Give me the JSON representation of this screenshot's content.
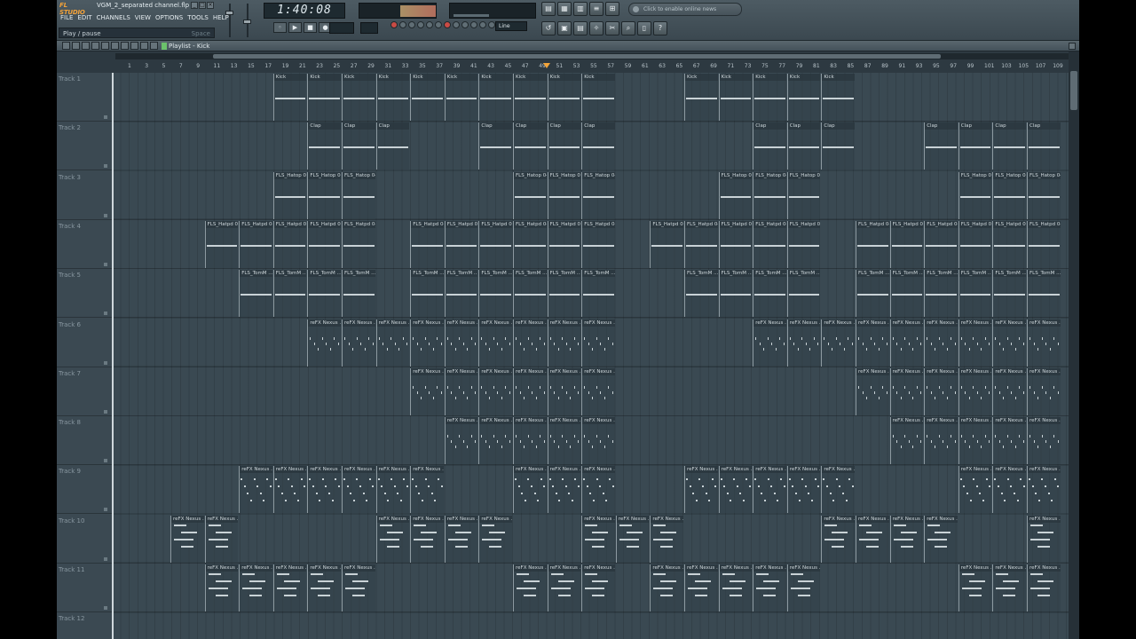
{
  "window": {
    "logo": "FL STUDIO",
    "filename": "VGM_2_separated channel.flp",
    "time_display": "1:40:08",
    "hint_text": "Play / pause",
    "hint_shortcut": "Space",
    "snap_value": "Line",
    "news_text": "Click to enable online news"
  },
  "menu": [
    "FILE",
    "EDIT",
    "CHANNELS",
    "VIEW",
    "OPTIONS",
    "TOOLS",
    "HELP"
  ],
  "playlist": {
    "title": "Playlist - Kick",
    "ruler": [
      "1",
      "3",
      "5",
      "7",
      "9",
      "11",
      "13",
      "15",
      "17",
      "19",
      "21",
      "23",
      "25",
      "27",
      "29",
      "31",
      "33",
      "35",
      "37",
      "39",
      "41",
      "43",
      "45",
      "47",
      "49",
      "51",
      "53",
      "55",
      "57",
      "59",
      "61",
      "63",
      "65",
      "67",
      "69",
      "71",
      "73",
      "75",
      "77",
      "79",
      "81",
      "83",
      "85",
      "87",
      "89",
      "91",
      "93",
      "95",
      "97",
      "99",
      "101",
      "103",
      "105",
      "107",
      "109"
    ],
    "tracks": [
      "Track 1",
      "Track 2",
      "Track 3",
      "Track 4",
      "Track 5",
      "Track 6",
      "Track 7",
      "Track 8",
      "Track 9",
      "Track 10",
      "Track 11",
      "Track 12"
    ],
    "clip_names": {
      "kick": "Kick",
      "clap": "Clap",
      "hat": "FLS_Hatop 04",
      "hat2": "FLS_Hatpd 04",
      "tom": "FLS_TomM ...",
      "nexus": "reFX Nexus ..."
    }
  },
  "colors": {
    "accent": "#f3a53a",
    "background": "#34424b",
    "clip_line": "#c9d2d6"
  }
}
